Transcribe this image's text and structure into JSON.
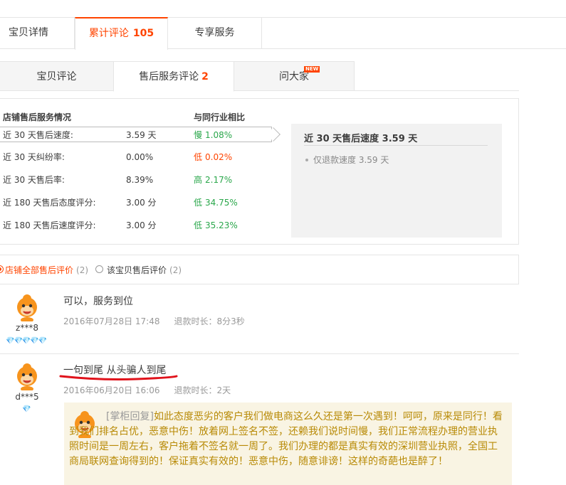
{
  "main_tabs": {
    "details": "宝贝详情",
    "reviews": "累计评论",
    "reviews_count": "105",
    "service": "专享服务"
  },
  "sub_tabs": {
    "item_reviews": "宝贝评论",
    "after_sale": "售后服务评论",
    "after_sale_count": "2",
    "ask_all": "问大家",
    "new_badge": "NEW"
  },
  "service_panel": {
    "header_left": "店铺售后服务情况",
    "header_right": "与同行业相比",
    "rows": [
      {
        "label": "近 30 天售后速度:",
        "value": "3.59 天",
        "level": "慢",
        "pct": "1.08%"
      },
      {
        "label": "近 30 天纠纷率:",
        "value": "0.00%",
        "level": "低",
        "pct": "0.02%"
      },
      {
        "label": "近 30 天售后率:",
        "value": "8.39%",
        "level": "高",
        "pct": "2.17%"
      },
      {
        "label": "近 180 天售后态度评分:",
        "value": "3.00 分",
        "level": "低",
        "pct": "34.75%"
      },
      {
        "label": "近 180 天售后速度评分:",
        "value": "3.00 分",
        "level": "低",
        "pct": "35.23%"
      }
    ],
    "side_title": "近 30 天售后速度 3.59 天",
    "side_item": "仅退款速度 3.59 天"
  },
  "filter": {
    "all_label": "店铺全部售后评价",
    "all_count": "(2)",
    "item_label": "该宝贝售后评价",
    "item_count": "(2)"
  },
  "reviews": [
    {
      "user": "z***8",
      "text": "可以，服务到位",
      "date": "2016年07月28日 17:48",
      "duration": "退款时长：8分3秒",
      "gems": "💎💎💎💎💎"
    },
    {
      "user": "d***5",
      "text": "一句到尾 从头骗人到尾",
      "date": "2016年06月20日 16:06",
      "duration": "退款时长：2天",
      "gems": "💎"
    }
  ],
  "reply": {
    "tag": "[掌柜回复]",
    "text": "如此态度恶劣的客户我们做电商这么久还是第一次遇到！呵呵，原来是同行！看到我们排名占优，恶意中伤！放着网上签名不签，还赖我们说时间慢，我们正常流程办理的营业执照时间是一周左右，客户拖着不签名就一周了。我们办理的都是真实有效的深圳营业执照，全国工商局联网查询得到的！保证真实有效的！恶意中伤，随意诽谤！这样的奇葩也是醉了！"
  },
  "colors": {
    "accent": "#ff4400",
    "green": "#2aa74b",
    "reply_bg": "#f9f4e3",
    "reply_text": "#b88a06"
  }
}
